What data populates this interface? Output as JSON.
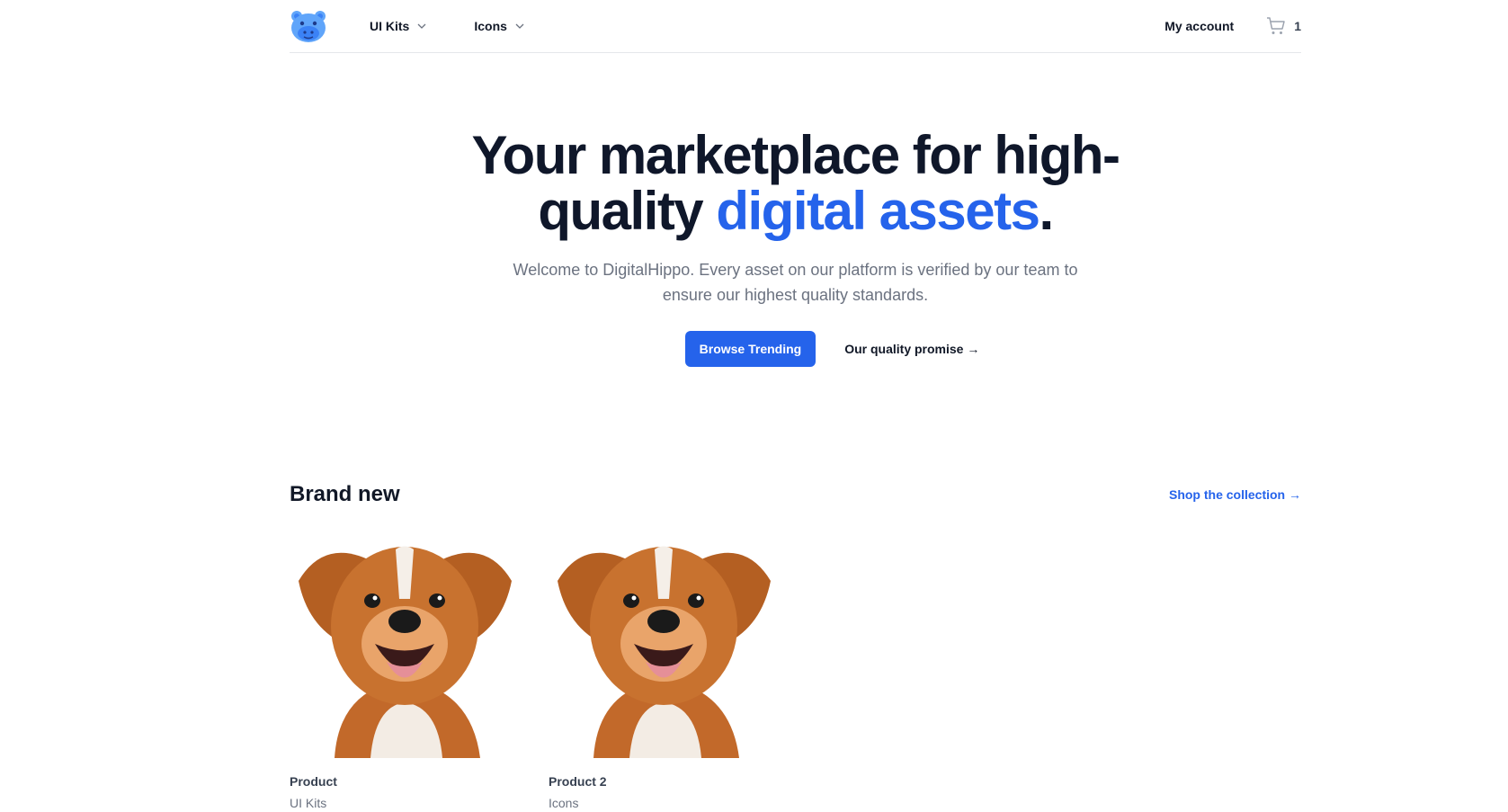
{
  "brand": {
    "logo_name": "DigitalHippo",
    "accent": "#2563eb",
    "logo_color": "#60a5fa"
  },
  "nav": {
    "items": [
      {
        "label": "UI Kits"
      },
      {
        "label": "Icons"
      }
    ],
    "account_label": "My account",
    "cart_count": "1"
  },
  "hero": {
    "title_part1": "Your marketplace for high-quality ",
    "title_accent": "digital assets",
    "title_end": ".",
    "subtitle": "Welcome to DigitalHippo. Every asset on our platform is verified by our team to ensure our highest quality standards.",
    "primary_button": "Browse Trending",
    "secondary_button": "Our quality promise →"
  },
  "brand_new": {
    "title": "Brand new",
    "link": "Shop the collection →",
    "products": [
      {
        "name": "Product",
        "category": "UI Kits",
        "image": "smiling-puppy"
      },
      {
        "name": "Product 2",
        "category": "Icons",
        "image": "smiling-puppy"
      }
    ]
  }
}
